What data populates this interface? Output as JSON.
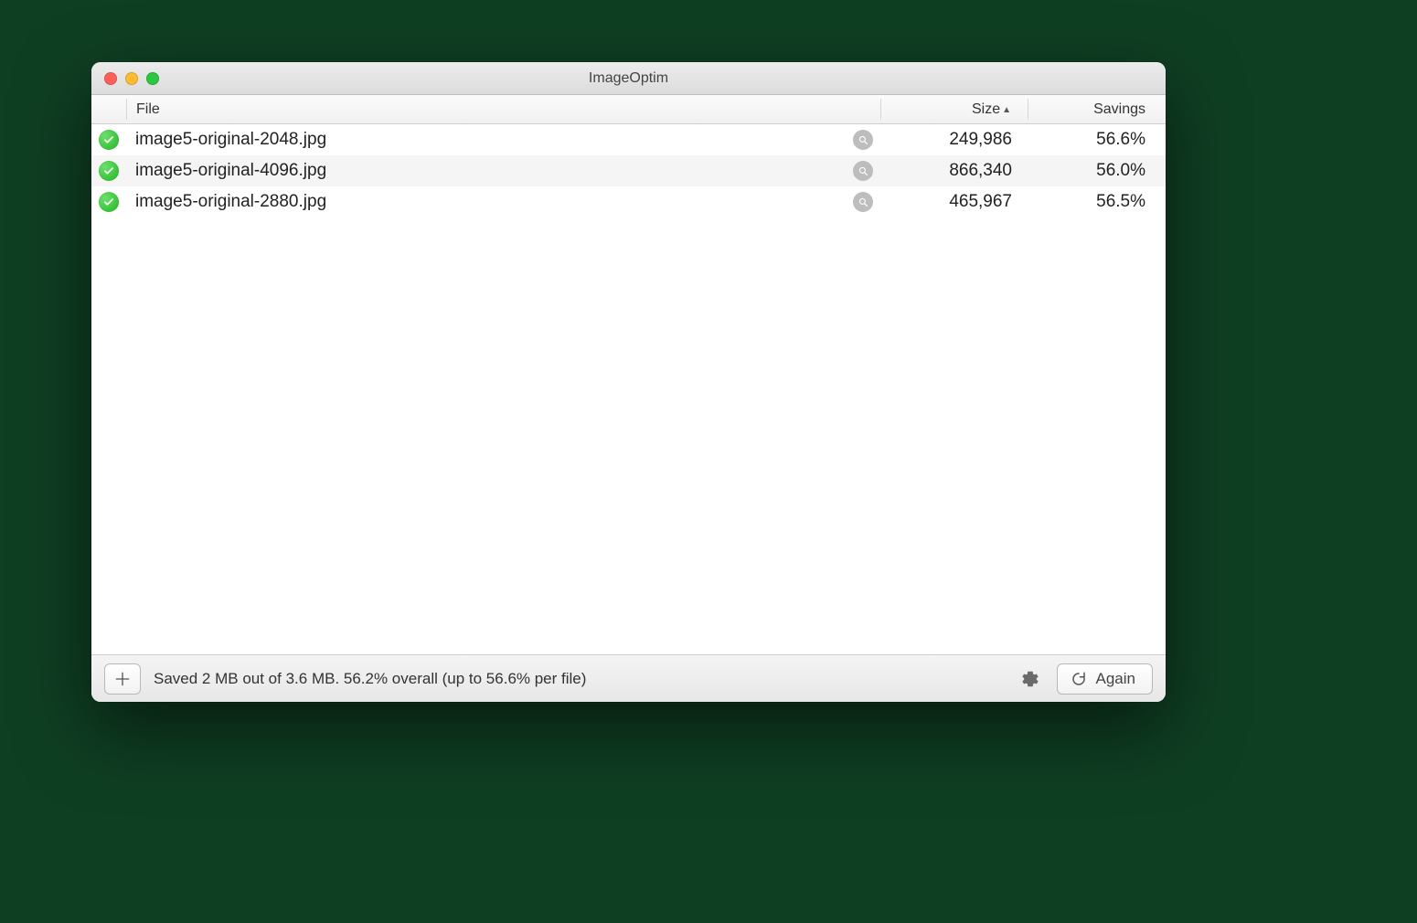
{
  "window": {
    "title": "ImageOptim"
  },
  "columns": {
    "file": "File",
    "size": "Size",
    "savings": "Savings",
    "sort": {
      "column": "size",
      "direction": "asc"
    }
  },
  "rows": [
    {
      "status": "done",
      "filename": "image5-original-2048.jpg",
      "size": "249,986",
      "savings": "56.6%"
    },
    {
      "status": "done",
      "filename": "image5-original-4096.jpg",
      "size": "866,340",
      "savings": "56.0%"
    },
    {
      "status": "done",
      "filename": "image5-original-2880.jpg",
      "size": "465,967",
      "savings": "56.5%"
    }
  ],
  "footer": {
    "status_text": "Saved 2 MB out of 3.6 MB. 56.2% overall (up to 56.6% per file)",
    "again_label": "Again"
  }
}
